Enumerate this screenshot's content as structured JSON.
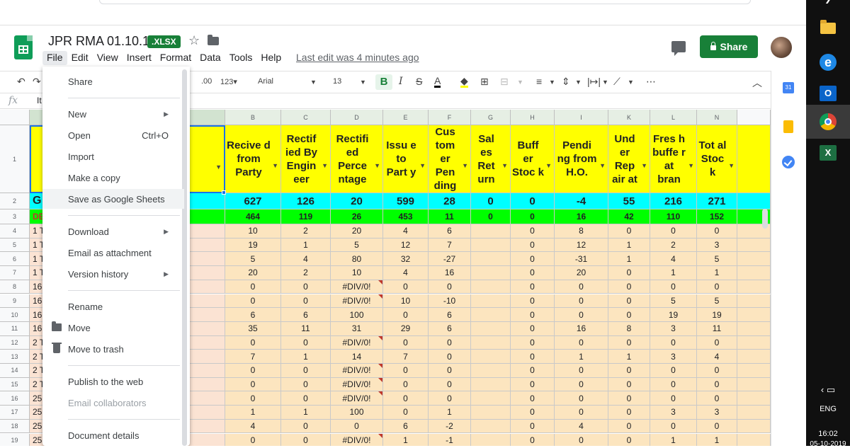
{
  "doc": {
    "title": "JPR RMA 01.10.19",
    "badge": ".XLSX",
    "last_edit": "Last edit was 4 minutes ago",
    "share_label": "Share"
  },
  "menubar": [
    "File",
    "Edit",
    "View",
    "Insert",
    "Format",
    "Data",
    "Tools",
    "Help"
  ],
  "toolbar": {
    "decimal_label": ".00",
    "format_label": "123▾",
    "font": "Arial",
    "font_size": "13",
    "more": "⋯"
  },
  "formula_bar": {
    "fx": "fx",
    "content": "It"
  },
  "file_menu": {
    "items": [
      {
        "label": "Share"
      },
      {
        "label": "New",
        "submenu": true
      },
      {
        "label": "Open",
        "shortcut": "Ctrl+O"
      },
      {
        "label": "Import"
      },
      {
        "label": "Make a copy"
      },
      {
        "label": "Save as Google Sheets",
        "highlighted": true
      },
      {
        "label": "Download",
        "submenu": true
      },
      {
        "label": "Email as attachment"
      },
      {
        "label": "Version history",
        "submenu": true
      },
      {
        "label": "Rename"
      },
      {
        "label": "Move",
        "icon": "folder-icon"
      },
      {
        "label": "Move to trash",
        "icon": "trash-icon"
      },
      {
        "label": "Publish to the web"
      },
      {
        "label": "Email collaborators",
        "disabled": true
      },
      {
        "label": "Document details"
      }
    ]
  },
  "sheet": {
    "columns": [
      "B",
      "C",
      "D",
      "E",
      "F",
      "G",
      "H",
      "I",
      "K",
      "L",
      "N"
    ],
    "row_numbers": [
      "1",
      "2",
      "3",
      "4",
      "5",
      "6",
      "7",
      "8",
      "9",
      "10",
      "11",
      "12",
      "13",
      "14",
      "15",
      "16",
      "17",
      "18",
      "19"
    ],
    "headers": [
      "Recive d from Party",
      "Rectif ied By Engin eer",
      "Rectifi ed Perce ntage",
      "Issu e to Part y",
      "Cus tom er Pen ding",
      "Sal es Ret urn",
      "Buff er Stoc k",
      "Pendi ng from H.O.",
      "Und er Rep air at",
      "Fres h buffe r at bran",
      "Tot al Stoc k"
    ],
    "left_col_row2": "G",
    "left_col_row3": "DE",
    "left_col_rows": [
      "1 T",
      "1 T",
      "1 T",
      "1 T",
      "16",
      "16",
      "16",
      "16",
      "2 T",
      "2 T",
      "2 T",
      "2 T",
      "25",
      "25",
      "25",
      "25"
    ],
    "totals": [
      "627",
      "126",
      "20",
      "599",
      "28",
      "0",
      "0",
      "-4",
      "55",
      "216",
      "271"
    ],
    "row3": [
      "464",
      "119",
      "26",
      "453",
      "11",
      "0",
      "0",
      "16",
      "42",
      "110",
      "152"
    ],
    "rows": [
      [
        "10",
        "2",
        "20",
        "4",
        "6",
        "",
        "0",
        "8",
        "0",
        "0",
        "0"
      ],
      [
        "19",
        "1",
        "5",
        "12",
        "7",
        "",
        "0",
        "12",
        "1",
        "2",
        "3"
      ],
      [
        "5",
        "4",
        "80",
        "32",
        "-27",
        "",
        "0",
        "-31",
        "1",
        "4",
        "5"
      ],
      [
        "20",
        "2",
        "10",
        "4",
        "16",
        "",
        "0",
        "20",
        "0",
        "1",
        "1"
      ],
      [
        "0",
        "0",
        "#DIV/0!",
        "0",
        "0",
        "",
        "0",
        "0",
        "0",
        "0",
        "0"
      ],
      [
        "0",
        "0",
        "#DIV/0!",
        "10",
        "-10",
        "",
        "0",
        "0",
        "0",
        "5",
        "5"
      ],
      [
        "6",
        "6",
        "100",
        "0",
        "6",
        "",
        "0",
        "0",
        "0",
        "19",
        "19"
      ],
      [
        "35",
        "11",
        "31",
        "29",
        "6",
        "",
        "0",
        "16",
        "8",
        "3",
        "11"
      ],
      [
        "0",
        "0",
        "#DIV/0!",
        "0",
        "0",
        "",
        "0",
        "0",
        "0",
        "0",
        "0"
      ],
      [
        "7",
        "1",
        "14",
        "7",
        "0",
        "",
        "0",
        "1",
        "1",
        "3",
        "4"
      ],
      [
        "0",
        "0",
        "#DIV/0!",
        "0",
        "0",
        "",
        "0",
        "0",
        "0",
        "0",
        "0"
      ],
      [
        "0",
        "0",
        "#DIV/0!",
        "0",
        "0",
        "",
        "0",
        "0",
        "0",
        "0",
        "0"
      ],
      [
        "0",
        "0",
        "#DIV/0!",
        "0",
        "0",
        "",
        "0",
        "0",
        "0",
        "0",
        "0"
      ],
      [
        "1",
        "1",
        "100",
        "0",
        "1",
        "",
        "0",
        "0",
        "0",
        "3",
        "3"
      ],
      [
        "4",
        "0",
        "0",
        "6",
        "-2",
        "",
        "0",
        "4",
        "0",
        "0",
        "0"
      ],
      [
        "0",
        "0",
        "#DIV/0!",
        "1",
        "-1",
        "",
        "0",
        "0",
        "0",
        "1",
        "1"
      ]
    ]
  },
  "taskbar": {
    "lang": "ENG",
    "time": "16:02",
    "date": "05-10-2019"
  },
  "colors": {
    "header_yellow": "#ffff00",
    "totals_cyan": "#00ffff",
    "row3_green": "#00ff00",
    "data_peach": "#fce5bf",
    "share_green": "#188038"
  }
}
